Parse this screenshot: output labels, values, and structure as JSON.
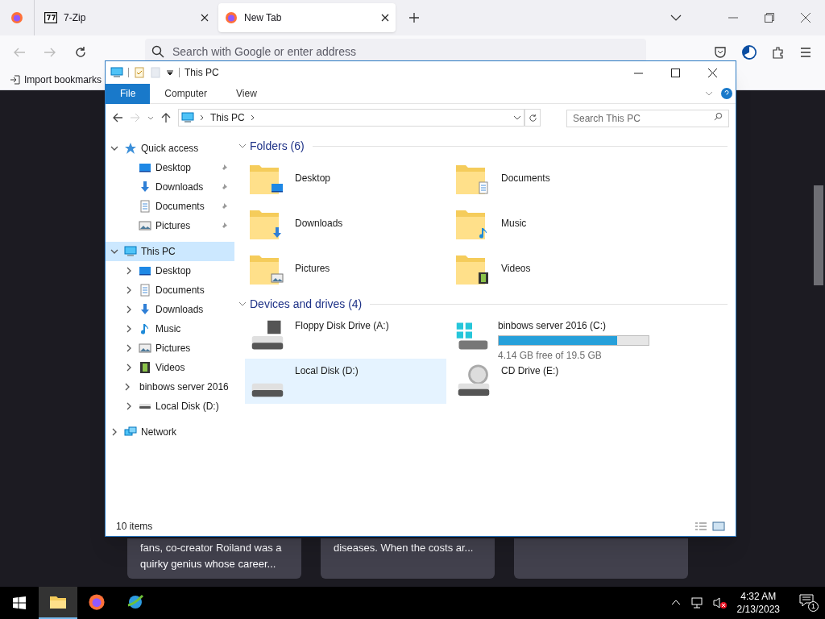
{
  "browser": {
    "tabs": [
      {
        "kind": "pinned",
        "selected": false
      },
      {
        "kind": "app",
        "label": "7-Zip",
        "selected": false
      },
      {
        "kind": "page",
        "label": "New Tab",
        "selected": true
      }
    ],
    "address_placeholder": "Search with Google or enter address",
    "bookmarks": [
      "Import bookmarks"
    ],
    "cards": [
      {
        "kind": "text",
        "text": "fans, co-creator Roiland was a quirky genius whose career..."
      },
      {
        "kind": "text",
        "text": "diseases. When the costs ar..."
      },
      {
        "kind": "blank"
      }
    ]
  },
  "explorer": {
    "title": "This PC",
    "ribbon_tabs": [
      {
        "label": "File",
        "selected": true
      },
      {
        "label": "Computer",
        "selected": false
      },
      {
        "label": "View",
        "selected": false
      }
    ],
    "breadcrumb": [
      "This PC"
    ],
    "search_placeholder": "Search This PC",
    "nav": [
      {
        "label": "Quick access",
        "kind": "star",
        "expanded": true,
        "selected": false,
        "children": [
          {
            "label": "Desktop",
            "kind": "desktop",
            "pinned": true,
            "selected": false
          },
          {
            "label": "Downloads",
            "kind": "downloads",
            "pinned": true,
            "selected": false
          },
          {
            "label": "Documents",
            "kind": "documents",
            "pinned": true,
            "selected": false
          },
          {
            "label": "Pictures",
            "kind": "pictures",
            "pinned": true,
            "selected": false
          }
        ]
      },
      {
        "label": "This PC",
        "kind": "pc",
        "expanded": true,
        "selected": true,
        "children": [
          {
            "label": "Desktop",
            "kind": "desktop",
            "expanded": false,
            "selected": false
          },
          {
            "label": "Documents",
            "kind": "documents",
            "expanded": false,
            "selected": false
          },
          {
            "label": "Downloads",
            "kind": "downloads",
            "expanded": false,
            "selected": false
          },
          {
            "label": "Music",
            "kind": "music",
            "expanded": false,
            "selected": false
          },
          {
            "label": "Pictures",
            "kind": "pictures",
            "expanded": false,
            "selected": false
          },
          {
            "label": "Videos",
            "kind": "videos",
            "expanded": false,
            "selected": false
          },
          {
            "label": "binbows server 2016",
            "kind": "windrive",
            "expanded": false,
            "selected": false
          },
          {
            "label": "Local Disk (D:)",
            "kind": "drive",
            "expanded": false,
            "selected": false
          }
        ]
      },
      {
        "label": "Network",
        "kind": "network",
        "expanded": false,
        "selected": false
      }
    ],
    "sections": [
      {
        "title": "Folders (6)",
        "expanded": true,
        "items": [
          {
            "name": "Desktop",
            "kind": "desktop",
            "selected": false
          },
          {
            "name": "Documents",
            "kind": "documents",
            "selected": false
          },
          {
            "name": "Downloads",
            "kind": "downloads",
            "selected": false
          },
          {
            "name": "Music",
            "kind": "music",
            "selected": false
          },
          {
            "name": "Pictures",
            "kind": "pictures",
            "selected": false
          },
          {
            "name": "Videos",
            "kind": "videos",
            "selected": false
          }
        ]
      },
      {
        "title": "Devices and drives (4)",
        "expanded": true,
        "items": [
          {
            "name": "Floppy Disk Drive (A:)",
            "kind": "floppy",
            "selected": false
          },
          {
            "name": "binbows server 2016 (C:)",
            "kind": "windrive",
            "selected": false,
            "level": 0.79,
            "reading": "4.14 GB free of 19.5 GB"
          },
          {
            "name": "Local Disk (D:)",
            "kind": "drive",
            "selected": true
          },
          {
            "name": "CD Drive (E:)",
            "kind": "cd",
            "selected": false
          }
        ]
      }
    ],
    "status": "10 items"
  },
  "taskbar": {
    "apps": [
      {
        "kind": "explorer",
        "active": true
      },
      {
        "kind": "firefox",
        "active": false
      },
      {
        "kind": "globe",
        "active": false
      }
    ],
    "time": "4:32 AM",
    "date": "2/13/2023",
    "notifications": "1"
  }
}
